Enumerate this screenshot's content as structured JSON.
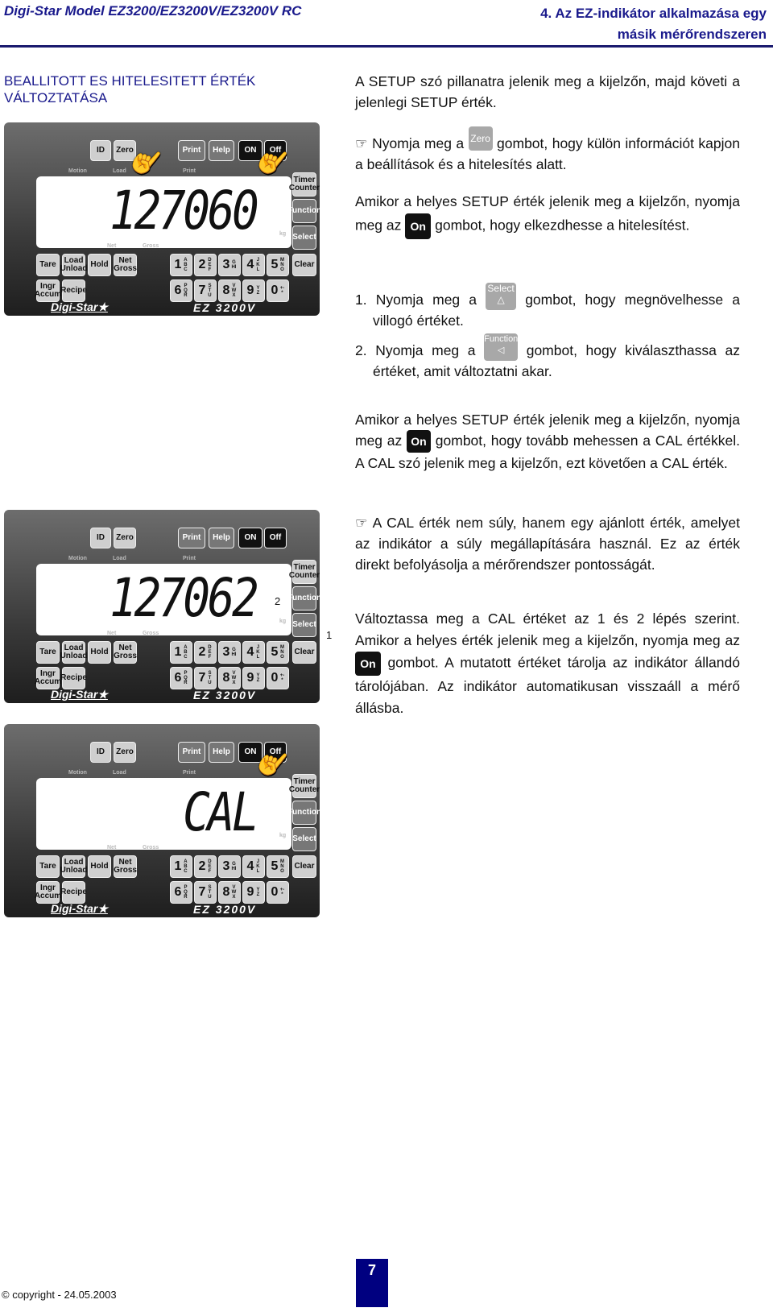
{
  "header": {
    "left": "Digi-Star Model EZ3200/EZ3200V/EZ3200V RC",
    "right_line1": "4. Az EZ-indikátor alkalmazása egy",
    "right_line2": "másik mérőrendszeren",
    "rule_color": "#1a1a6e"
  },
  "section_title": {
    "line1": "BEALLITOTT ES HITELESITETT ÉRTÉK",
    "line2": "VÁLTOZTATÁSA"
  },
  "paragraphs": {
    "p1": "A SETUP szó pillanatra jelenik meg a kijelzőn, majd követi a jelenlegi SETUP érték.",
    "p2_pre": "Nyomja meg a",
    "p2_btn": "Zero",
    "p2_post": "gombot, hogy külön információt kapjon a beállítások és a hitelesítés alatt.",
    "p3_pre": "Amikor a helyes SETUP érték jelenik meg a kijelzőn, nyomja meg az",
    "p3_btn": "On",
    "p3_post": "gombot, hogy elkezdhesse a hitelesítést.",
    "s1_pre": "1. Nyomja meg a",
    "s1_btn": "Select",
    "s1_post": "gombot, hogy megnövelhesse a villogó értéket.",
    "s2_pre": "2. Nyomja meg a",
    "s2_btn": "Function",
    "s2_post": "gombot, hogy kiválaszthassa az értéket, amit változtatni akar.",
    "p4_pre": "Amikor a helyes SETUP érték jelenik meg a kijelzőn, nyomja meg az",
    "p4_btn": "On",
    "p4_post": "gombot, hogy tovább mehessen a CAL értékkel. A CAL szó jelenik meg a kijelzőn, ezt követően a CAL érték.",
    "p5": "A CAL érték nem súly, hanem egy ajánlott érték, amelyet az indikátor a súly megállapítására használ. Ez az érték direkt befolyásolja a mérőrendszer pontosságát.",
    "p6_pre": "Változtassa meg a CAL értéket az 1 és 2 lépés szerint. Amikor a helyes érték jelenik meg a kijelzőn, nyomja meg az",
    "p6_btn": "On",
    "p6_post": "gombot. A mutatott értéket tárolja az indikátor állandó tárolójában. Az indikátor automatikusan visszaáll a mérő állásba."
  },
  "panel_keys": {
    "id": "ID",
    "zero": "Zero",
    "print": "Print",
    "help": "Help",
    "on": "ON",
    "off": "Off",
    "timer": "Timer Counter",
    "function": "Function",
    "select": "Select",
    "tare": "Tare",
    "load": "Load Unload",
    "hold": "Hold",
    "netgross": "Net Gross",
    "ingr": "Ingr Accum",
    "recipe": "Recipe",
    "clear": "Clear",
    "nums": [
      "1",
      "2",
      "3",
      "4",
      "5",
      "6",
      "7",
      "8",
      "9",
      "0"
    ],
    "letters": [
      "ABC",
      "DEF",
      "GHI",
      "JKL",
      "MNO",
      "PQR",
      "STU",
      "VWX",
      "YZ",
      "+-*"
    ]
  },
  "panel_labels": {
    "motion": "Motion",
    "load": "Load",
    "print": "Print",
    "net": "Net",
    "gross": "Gross",
    "kg": "kg",
    "logo": "Digi-Star★",
    "model": "EZ 3200V"
  },
  "panels": [
    {
      "display": "127060"
    },
    {
      "display": "127062",
      "ann1": "1",
      "ann2": "2"
    },
    {
      "display": "CAL"
    }
  ],
  "footer": {
    "copyright": "© copyright - 24.05.2003",
    "page": "7"
  }
}
